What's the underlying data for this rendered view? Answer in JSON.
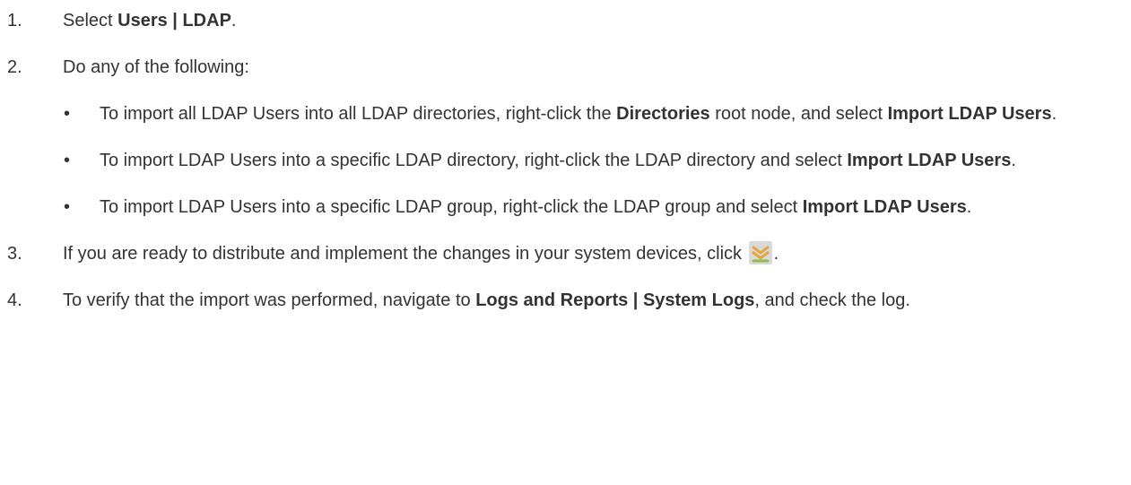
{
  "steps": [
    {
      "num": "1.",
      "before": "Select ",
      "bold": "Users | LDAP",
      "after": "."
    },
    {
      "num": "2.",
      "text": "Do any of the following:",
      "bullets": [
        {
          "dot": "•",
          "t1": "To import all LDAP Users into all LDAP directories, right-click the ",
          "b1": "Directories",
          "t2": " root node, and select ",
          "b2": "Import LDAP Users",
          "t3": "."
        },
        {
          "dot": "•",
          "t1": "To import LDAP Users into a specific LDAP directory, right-click the LDAP directory and select ",
          "b1": "Import LDAP Users",
          "t2": "."
        },
        {
          "dot": "•",
          "t1": "To import LDAP Users into a specific LDAP group, right-click the LDAP group and select ",
          "b1": "Import LDAP Users",
          "t2": "."
        }
      ]
    },
    {
      "num": "3.",
      "before": "If you are ready to distribute and implement the changes in your system devices, click ",
      "icon": "install-policy-icon",
      "after": "."
    },
    {
      "num": "4.",
      "before": "To verify that the import was performed, navigate to ",
      "bold": "Logs and Reports | System Logs",
      "after": ", and check the log."
    }
  ],
  "colors": {
    "text": "#333333",
    "icon_bg": "#d9d9d9",
    "icon_orange": "#e8a23a",
    "icon_green": "#8cc04a"
  }
}
